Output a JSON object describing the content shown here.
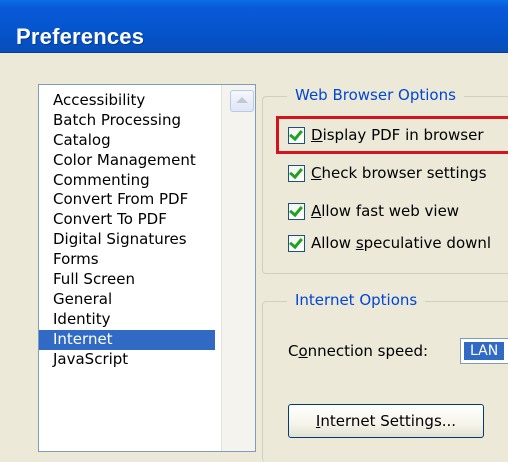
{
  "window": {
    "title": "Preferences"
  },
  "categories": {
    "items": [
      "Accessibility",
      "Batch Processing",
      "Catalog",
      "Color Management",
      "Commenting",
      "Convert From PDF",
      "Convert To PDF",
      "Digital Signatures",
      "Forms",
      "Full Screen",
      "General",
      "Identity",
      "Internet",
      "JavaScript"
    ],
    "selected": "Internet"
  },
  "web_browser_options": {
    "legend": "Web Browser Options",
    "options": [
      {
        "access_key": "D",
        "rest": "isplay PDF in browser",
        "checked": true
      },
      {
        "access_key": "C",
        "rest": "heck browser settings",
        "checked": true
      },
      {
        "access_key": "A",
        "rest": "llow fast web view",
        "checked": true
      },
      {
        "pre": "Allow ",
        "access_key": "s",
        "rest": "peculative downl",
        "checked": true
      }
    ]
  },
  "internet_options": {
    "legend": "Internet Options",
    "connection_label_pre": "C",
    "connection_label_key": "o",
    "connection_label_rest": "nnection speed:",
    "connection_value": "LAN",
    "settings_button_key": "I",
    "settings_button_rest": "nternet Settings..."
  },
  "colors": {
    "titlebar": "#0656d0",
    "selection": "#316ac5",
    "legend": "#0046d5",
    "highlight": "#d4141c",
    "check": "#21a121"
  }
}
